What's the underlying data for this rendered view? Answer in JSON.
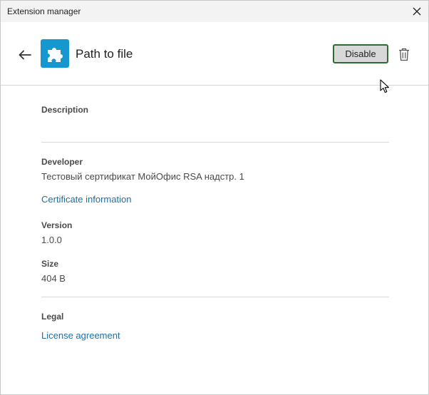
{
  "window": {
    "title": "Extension manager"
  },
  "extension": {
    "name": "Path to file",
    "icon": "puzzle-piece-icon",
    "icon_color": "#1797cf",
    "actions": {
      "disable_label": "Disable"
    }
  },
  "details": {
    "description_label": "Description",
    "description_value": "",
    "developer_label": "Developer",
    "developer_value": "Тестовый сертификат МойОфис RSA надстр. 1",
    "certificate_link": "Certificate information",
    "version_label": "Version",
    "version_value": "1.0.0",
    "size_label": "Size",
    "size_value": "404 B",
    "legal_label": "Legal",
    "license_link": "License agreement"
  },
  "colors": {
    "link": "#1f6fa3",
    "button_border": "#2f6a35",
    "button_fill": "#d8d8d8"
  }
}
